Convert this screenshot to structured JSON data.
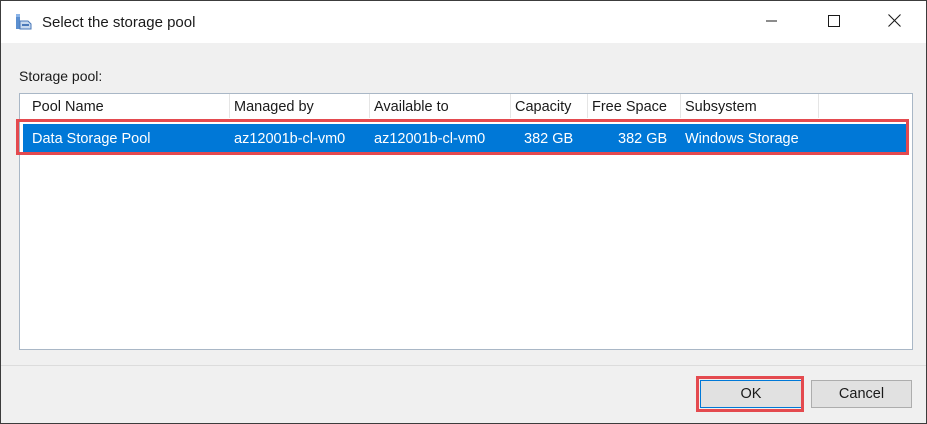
{
  "window": {
    "title": "Select the storage pool",
    "icon": "storage-pool-icon",
    "controls": [
      "minimize-icon",
      "maximize-icon",
      "close-icon"
    ]
  },
  "storage_pool": {
    "label": "Storage pool:",
    "columns": [
      "Pool Name",
      "Managed by",
      "Available to",
      "Capacity",
      "Free Space",
      "Subsystem"
    ],
    "rows": [
      {
        "pool_name": "Data Storage Pool",
        "managed_by": "az12001b-cl-vm0",
        "available_to": "az12001b-cl-vm0",
        "capacity": "382 GB",
        "free_space": "382 GB",
        "subsystem": "Windows Storage",
        "selected": true
      }
    ]
  },
  "buttons": {
    "ok": "OK",
    "cancel": "Cancel"
  },
  "colors": {
    "selection": "#0078d7",
    "highlight_outline": "#e44a4f",
    "dialog_bg": "#f0f0f0"
  }
}
